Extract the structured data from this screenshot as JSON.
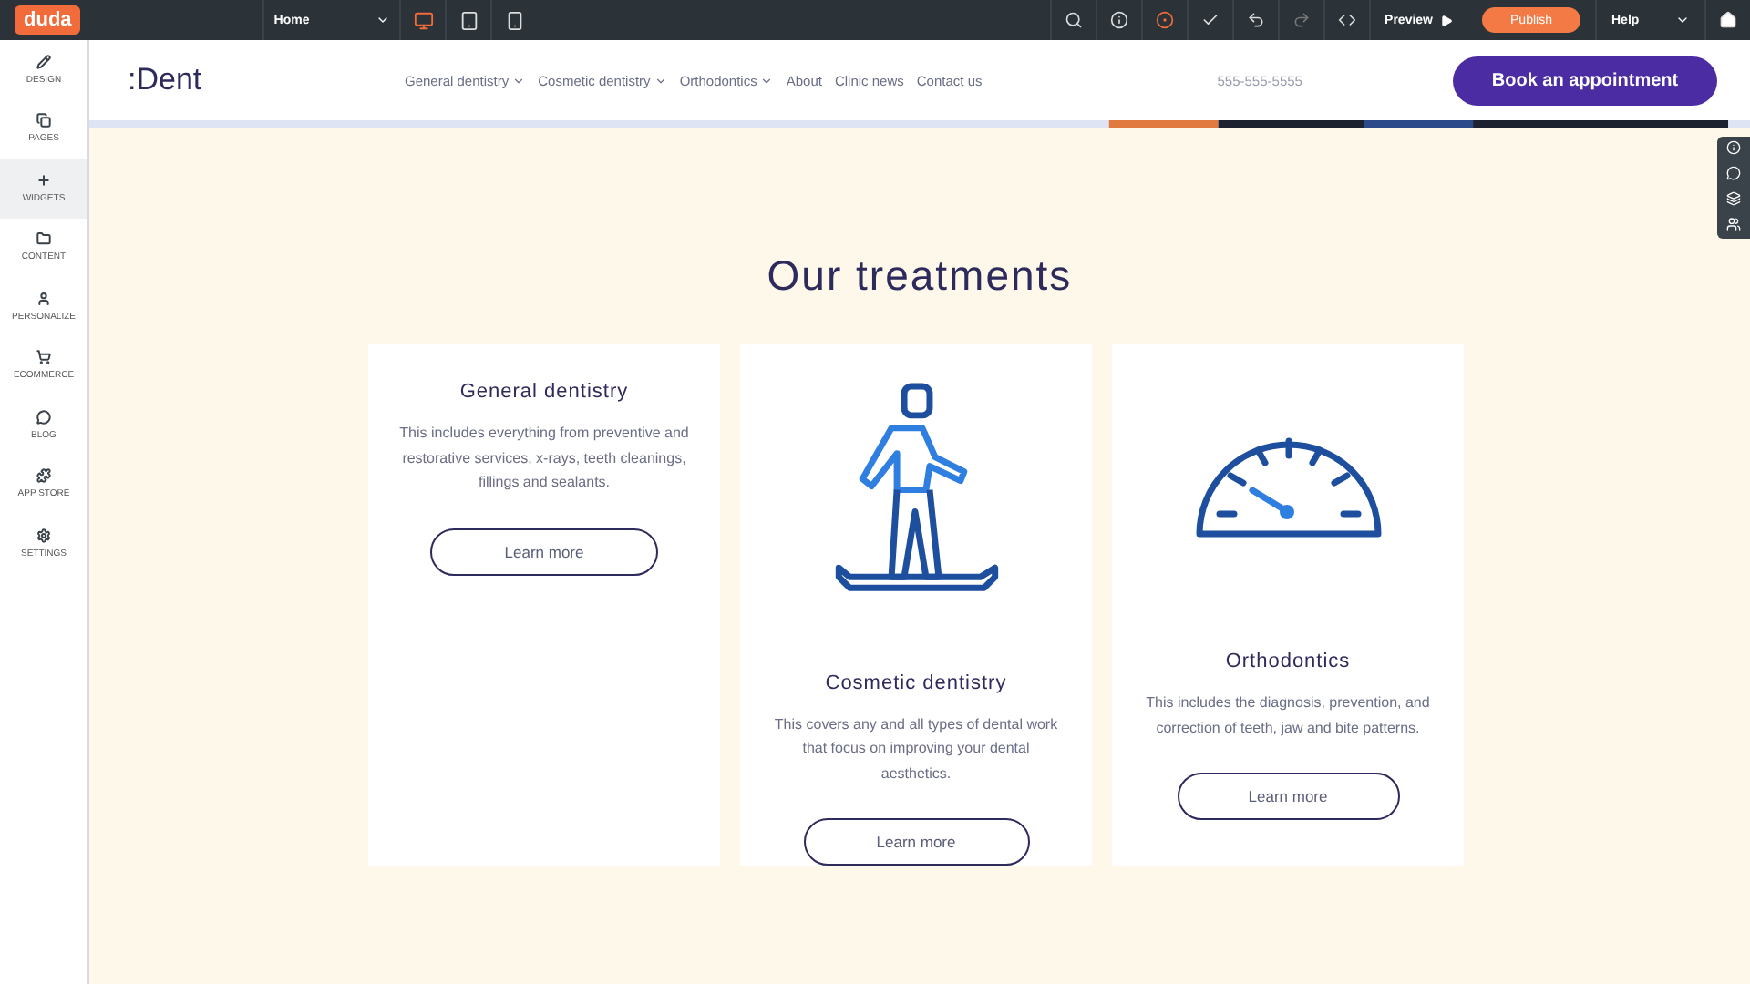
{
  "toolbar": {
    "logo": "duda",
    "page_select": "Home",
    "devices": [
      {
        "kind": "desktop",
        "selected": true
      },
      {
        "kind": "tablet",
        "selected": false
      },
      {
        "kind": "mobile",
        "selected": false
      }
    ],
    "preview": "Preview",
    "publish": "Publish",
    "help": "Help"
  },
  "sidebar": {
    "items": [
      {
        "kind": "design",
        "label": "DESIGN",
        "selected": false
      },
      {
        "kind": "pages",
        "label": "PAGES",
        "selected": false
      },
      {
        "kind": "widgets",
        "label": "WIDGETS",
        "selected": true
      },
      {
        "kind": "content",
        "label": "CONTENT",
        "selected": false
      },
      {
        "kind": "personalize",
        "label": "PERSONALIZE",
        "selected": false
      },
      {
        "kind": "ecommerce",
        "label": "ECOMMERCE",
        "selected": false
      },
      {
        "kind": "blog",
        "label": "BLOG",
        "selected": false
      },
      {
        "kind": "appstore",
        "label": "APP STORE",
        "selected": false
      },
      {
        "kind": "settings",
        "label": "SETTINGS",
        "selected": false
      }
    ]
  },
  "site": {
    "logo": ":Dent",
    "nav": [
      {
        "label": "General dentistry",
        "dropdown": true
      },
      {
        "label": "Cosmetic dentistry",
        "dropdown": true
      },
      {
        "label": "Orthodontics",
        "dropdown": true
      },
      {
        "label": "About",
        "dropdown": false
      },
      {
        "label": "Clinic news",
        "dropdown": false
      },
      {
        "label": "Contact us",
        "dropdown": false
      }
    ],
    "phone": "555-555-5555",
    "cta": "Book an appointment"
  },
  "section": {
    "title": "Our treatments",
    "cards": [
      {
        "kind": "plain",
        "title": "General dentistry",
        "text": "This includes everything from preventive and restorative services, x-rays, teeth cleanings, fillings and sealants.",
        "button": "Learn more"
      },
      {
        "kind": "skater",
        "title": "Cosmetic dentistry",
        "text": "This covers any and all types of dental work that focus on improving your dental aesthetics.",
        "button": "Learn more"
      },
      {
        "kind": "gauge",
        "title": "Orthodontics",
        "text": "This includes the diagnosis, prevention, and correction of teeth, jaw and  bite patterns.",
        "button": "Learn more"
      }
    ]
  }
}
